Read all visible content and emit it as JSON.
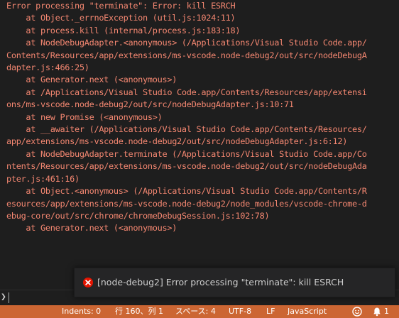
{
  "console": {
    "lines": [
      "Error processing \"terminate\": Error: kill ESRCH",
      "    at Object._errnoException (util.js:1024:11)",
      "    at process.kill (internal/process.js:183:18)",
      "    at NodeDebugAdapter.<anonymous> (/Applications/Visual Studio Code.app/",
      "Contents/Resources/app/extensions/ms-vscode.node-debug2/out/src/nodeDebugA",
      "dapter.js:466:25)",
      "    at Generator.next (<anonymous>)",
      "    at /Applications/Visual Studio Code.app/Contents/Resources/app/extensi",
      "ons/ms-vscode.node-debug2/out/src/nodeDebugAdapter.js:10:71",
      "    at new Promise (<anonymous>)",
      "    at __awaiter (/Applications/Visual Studio Code.app/Contents/Resources/",
      "app/extensions/ms-vscode.node-debug2/out/src/nodeDebugAdapter.js:6:12)",
      "    at NodeDebugAdapter.terminate (/Applications/Visual Studio Code.app/Co",
      "ntents/Resources/app/extensions/ms-vscode.node-debug2/out/src/nodeDebugAda",
      "pter.js:461:16)",
      "    at Object.<anonymous> (/Applications/Visual Studio Code.app/Contents/R",
      "esources/app/extensions/ms-vscode.node-debug2/node_modules/vscode-chrome-d",
      "ebug-core/out/src/chrome/chromeDebugSession.js:102:78)",
      "    at Generator.next (<anonymous>)"
    ],
    "error_color": "#f48771"
  },
  "prompt": {
    "caret": "❯"
  },
  "notification": {
    "icon": "error-icon",
    "message": "[node-debug2] Error processing \"terminate\": kill ESRCH"
  },
  "statusbar": {
    "background": "#cc6633",
    "indents": "Indents: 0",
    "position": "行 160、列 1",
    "spaces": "スペース: 4",
    "encoding": "UTF-8",
    "eol": "LF",
    "language": "JavaScript",
    "feedback_icon": "smiley-icon",
    "notifications_icon": "bell-icon",
    "notifications_count": "1"
  }
}
